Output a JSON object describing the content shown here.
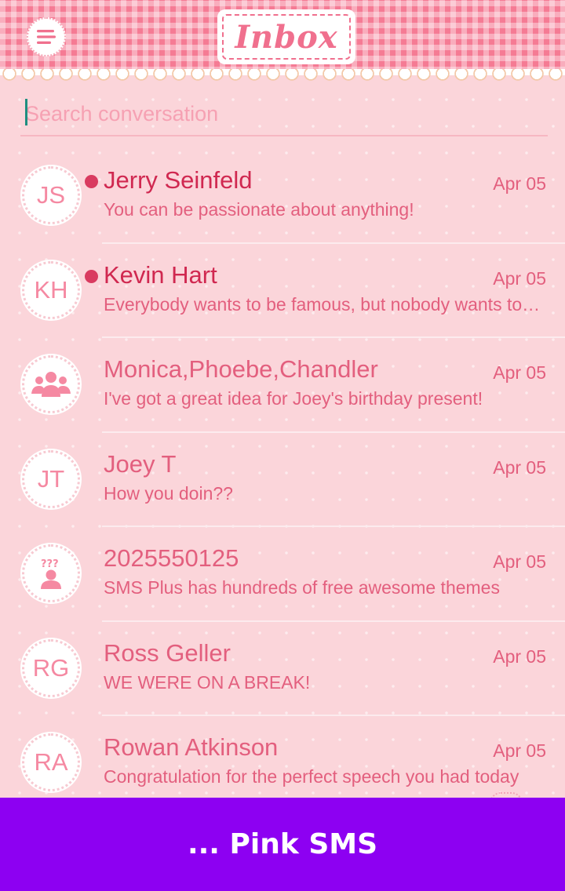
{
  "header": {
    "title": "Inbox",
    "menu_icon": "hamburger-menu-icon"
  },
  "search": {
    "placeholder": "Search conversation",
    "value": ""
  },
  "conversations": [
    {
      "avatar": "JS",
      "name": "Jerry Seinfeld",
      "date": "Apr 05",
      "preview": "You can be passionate about anything!",
      "unread": true
    },
    {
      "avatar": "KH",
      "name": "Kevin Hart",
      "date": "Apr 05",
      "preview": "Everybody wants to be famous, but nobody wants to do the work",
      "unread": true
    },
    {
      "avatar_icon": "group-icon",
      "name": "Monica,Phoebe,Chandler",
      "date": "Apr 05",
      "preview": "I've got a great idea for Joey's birthday present!",
      "unread": false
    },
    {
      "avatar": "JT",
      "name": "Joey T",
      "date": "Apr 05",
      "preview": "How you doin??",
      "unread": false
    },
    {
      "avatar_icon": "unknown-contact-icon",
      "name": "2025550125",
      "date": "Apr 05",
      "preview": "SMS Plus has hundreds of free awesome themes",
      "unread": false
    },
    {
      "avatar": "RG",
      "name": "Ross Geller",
      "date": "Apr 05",
      "preview": "WE WERE ON A BREAK!",
      "unread": false
    },
    {
      "avatar": "RA",
      "name": "Rowan Atkinson",
      "date": "Apr 05",
      "preview": "Congratulation for the perfect speech you had today",
      "unread": false
    }
  ],
  "banner": {
    "text": "... Pink SMS"
  },
  "colors": {
    "background": "#fbd5da",
    "header": "#f57b94",
    "unread_name": "#d02850",
    "text": "#e35f7e",
    "unread_dot": "#d93b60",
    "banner": "#8d00f2"
  }
}
